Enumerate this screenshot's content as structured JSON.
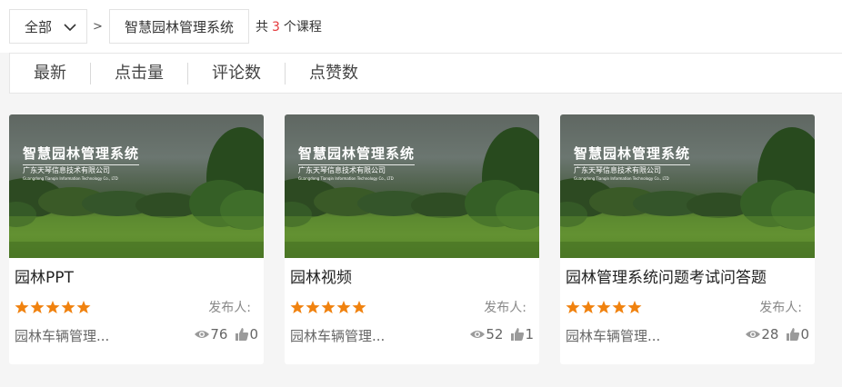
{
  "filter": {
    "selected": "全部",
    "separator": ">",
    "category": "智慧园林管理系统"
  },
  "summary": {
    "prefix": "共",
    "count": "3",
    "suffix": "个课程"
  },
  "sort_tabs": [
    "最新",
    "点击量",
    "评论数",
    "点赞数"
  ],
  "thumbnail": {
    "title": "智慧园林管理系统",
    "company": "广东天琴信息技术有限公司",
    "company_en": "Guangdong Tianqin Information Technology Co., LTD"
  },
  "courses": [
    {
      "title": "园林PPT",
      "rating": 5,
      "publisher_label": "发布人:",
      "dept": "园林车辆管理...",
      "views": "76",
      "likes": "0"
    },
    {
      "title": "园林视频",
      "rating": 5,
      "publisher_label": "发布人:",
      "dept": "园林车辆管理...",
      "views": "52",
      "likes": "1"
    },
    {
      "title": "园林管理系统问题考试问答题",
      "rating": 5,
      "publisher_label": "发布人:",
      "dept": "园林车辆管理...",
      "views": "28",
      "likes": "0"
    }
  ],
  "colors": {
    "accent": "#e4393c",
    "star": "#f0820f",
    "icon": "#9a9a9a"
  }
}
